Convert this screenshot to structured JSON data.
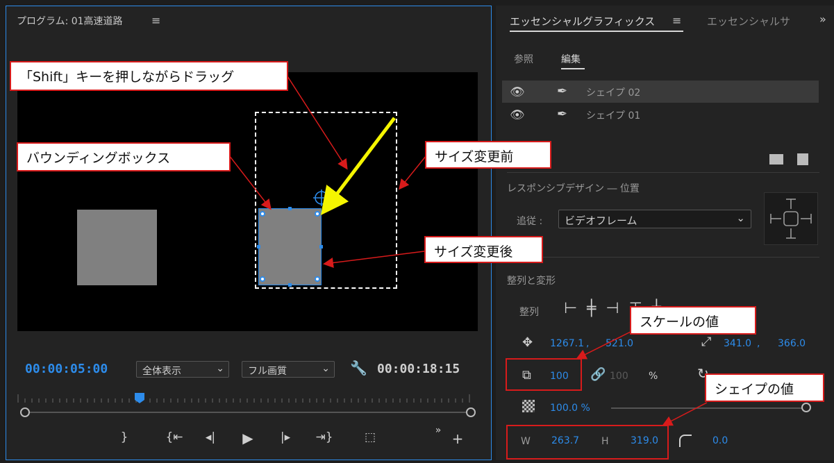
{
  "program": {
    "title": "プログラム: 01高速道路",
    "menu_icon": "hamburger-icon",
    "current_time": "00:00:05:00",
    "zoom_select": "全体表示",
    "quality_select": "フル画質",
    "duration": "00:00:18:15"
  },
  "essential": {
    "tab_active": "エッセンシャルグラフィックス",
    "tab_other": "エッセンシャルサ",
    "subtab_browse": "参照",
    "subtab_edit": "編集",
    "layers": [
      {
        "label": "シェイプ 02"
      },
      {
        "label": "シェイプ 01"
      }
    ],
    "responsive_title": "レスポンシブデザイン ― 位置",
    "follow_label": "追従 :",
    "follow_value": "ビデオフレーム",
    "align_section": "整列と変形",
    "align_label": "整列",
    "position_x": "1267.1",
    "position_comma": ",",
    "position_y": "521.0",
    "anchor_x": "341.0",
    "anchor_comma": ",",
    "anchor_y": "366.0",
    "scale": "100",
    "scale_linked": "100",
    "percent": "%",
    "opacity": "100.0 %",
    "width_label": "W",
    "width_value": "263.7",
    "height_label": "H",
    "height_value": "319.0",
    "corner_value": "0.0"
  },
  "callouts": {
    "shift_drag": "「Shift」キーを押しながらドラッグ",
    "bounding_box": "バウンディングボックス",
    "before_resize": "サイズ変更前",
    "after_resize": "サイズ変更後",
    "scale_value": "スケールの値",
    "shape_value": "シェイプの値"
  },
  "colors": {
    "accent_blue": "#2d8ceb",
    "annotation_red": "#d81b1b",
    "arrow_yellow": "#f5f500",
    "shape_gray": "#808080"
  }
}
